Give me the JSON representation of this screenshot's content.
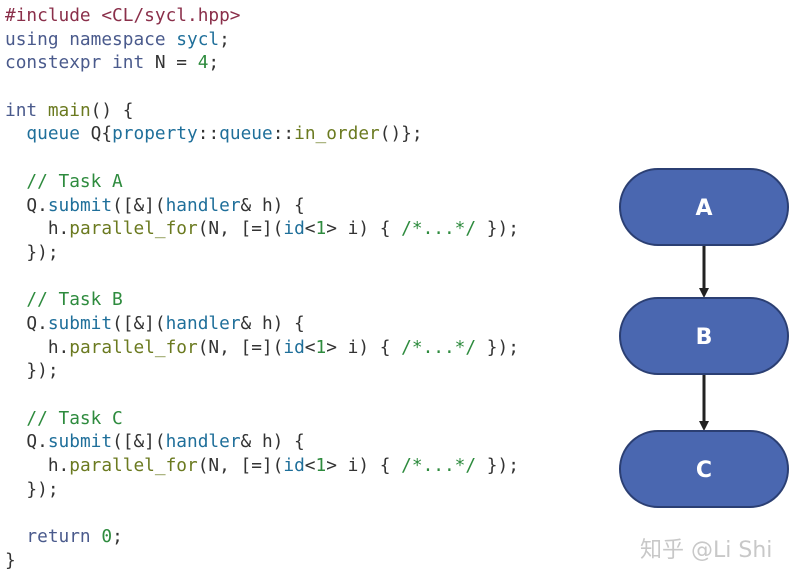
{
  "code": {
    "lines": [
      [
        {
          "t": "#include <CL/sycl.hpp>",
          "c": "pre"
        }
      ],
      [
        {
          "t": "using namespace ",
          "c": "kw"
        },
        {
          "t": "sycl",
          "c": "ty"
        },
        {
          "t": ";",
          "c": "pl"
        }
      ],
      [
        {
          "t": "constexpr int ",
          "c": "kw"
        },
        {
          "t": "N = ",
          "c": "pl"
        },
        {
          "t": "4",
          "c": "num"
        },
        {
          "t": ";",
          "c": "pl"
        }
      ],
      [],
      [
        {
          "t": "int ",
          "c": "kw"
        },
        {
          "t": "main",
          "c": "fn"
        },
        {
          "t": "() {",
          "c": "pl"
        }
      ],
      [
        {
          "t": "  ",
          "c": "pl"
        },
        {
          "t": "queue",
          "c": "ty"
        },
        {
          "t": " Q{",
          "c": "pl"
        },
        {
          "t": "property",
          "c": "ty"
        },
        {
          "t": "::",
          "c": "pl"
        },
        {
          "t": "queue",
          "c": "ty"
        },
        {
          "t": "::",
          "c": "pl"
        },
        {
          "t": "in_order",
          "c": "fn"
        },
        {
          "t": "()};",
          "c": "pl"
        }
      ],
      [],
      [
        {
          "t": "  // Task A",
          "c": "com"
        }
      ],
      [
        {
          "t": "  Q.",
          "c": "pl"
        },
        {
          "t": "submit",
          "c": "ty"
        },
        {
          "t": "([&](",
          "c": "pl"
        },
        {
          "t": "handler",
          "c": "ty"
        },
        {
          "t": "& h) {",
          "c": "pl"
        }
      ],
      [
        {
          "t": "    h.",
          "c": "pl"
        },
        {
          "t": "parallel_for",
          "c": "fn"
        },
        {
          "t": "(N, [=](",
          "c": "pl"
        },
        {
          "t": "id",
          "c": "ty"
        },
        {
          "t": "<",
          "c": "pl"
        },
        {
          "t": "1",
          "c": "num"
        },
        {
          "t": "> i) { ",
          "c": "pl"
        },
        {
          "t": "/*...*/",
          "c": "com"
        },
        {
          "t": " });",
          "c": "pl"
        }
      ],
      [
        {
          "t": "  });",
          "c": "pl"
        }
      ],
      [],
      [
        {
          "t": "  // Task B",
          "c": "com"
        }
      ],
      [
        {
          "t": "  Q.",
          "c": "pl"
        },
        {
          "t": "submit",
          "c": "ty"
        },
        {
          "t": "([&](",
          "c": "pl"
        },
        {
          "t": "handler",
          "c": "ty"
        },
        {
          "t": "& h) {",
          "c": "pl"
        }
      ],
      [
        {
          "t": "    h.",
          "c": "pl"
        },
        {
          "t": "parallel_for",
          "c": "fn"
        },
        {
          "t": "(N, [=](",
          "c": "pl"
        },
        {
          "t": "id",
          "c": "ty"
        },
        {
          "t": "<",
          "c": "pl"
        },
        {
          "t": "1",
          "c": "num"
        },
        {
          "t": "> i) { ",
          "c": "pl"
        },
        {
          "t": "/*...*/",
          "c": "com"
        },
        {
          "t": " });",
          "c": "pl"
        }
      ],
      [
        {
          "t": "  });",
          "c": "pl"
        }
      ],
      [],
      [
        {
          "t": "  // Task C",
          "c": "com"
        }
      ],
      [
        {
          "t": "  Q.",
          "c": "pl"
        },
        {
          "t": "submit",
          "c": "ty"
        },
        {
          "t": "([&](",
          "c": "pl"
        },
        {
          "t": "handler",
          "c": "ty"
        },
        {
          "t": "& h) {",
          "c": "pl"
        }
      ],
      [
        {
          "t": "    h.",
          "c": "pl"
        },
        {
          "t": "parallel_for",
          "c": "fn"
        },
        {
          "t": "(N, [=](",
          "c": "pl"
        },
        {
          "t": "id",
          "c": "ty"
        },
        {
          "t": "<",
          "c": "pl"
        },
        {
          "t": "1",
          "c": "num"
        },
        {
          "t": "> i) { ",
          "c": "pl"
        },
        {
          "t": "/*...*/",
          "c": "com"
        },
        {
          "t": " });",
          "c": "pl"
        }
      ],
      [
        {
          "t": "  });",
          "c": "pl"
        }
      ],
      [],
      [
        {
          "t": "  return ",
          "c": "kw"
        },
        {
          "t": "0",
          "c": "num"
        },
        {
          "t": ";",
          "c": "pl"
        }
      ],
      [
        {
          "t": "}",
          "c": "pl"
        }
      ]
    ]
  },
  "diagram": {
    "nodes": [
      {
        "id": "A",
        "label": "A"
      },
      {
        "id": "B",
        "label": "B"
      },
      {
        "id": "C",
        "label": "C"
      }
    ],
    "edges": [
      {
        "from": "A",
        "to": "B"
      },
      {
        "from": "B",
        "to": "C"
      }
    ],
    "colors": {
      "node_fill": "#4a67b0",
      "node_stroke": "#2b3f73",
      "edge": "#222222",
      "text": "#ffffff"
    }
  },
  "watermark": "知乎 @Li Shi"
}
